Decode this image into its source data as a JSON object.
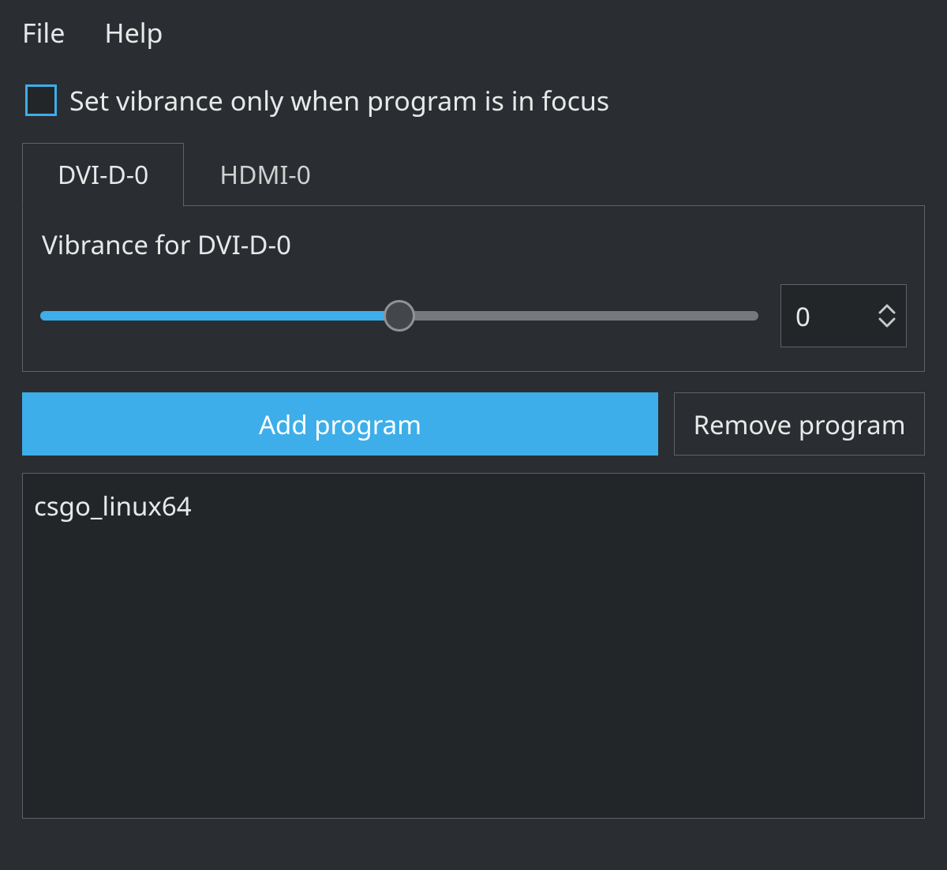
{
  "menu": {
    "file": "File",
    "help": "Help"
  },
  "focus_checkbox": {
    "checked": false,
    "label": "Set vibrance only when program is in focus"
  },
  "tabs": [
    {
      "id": "dvi-d-0",
      "label": "DVI-D-0",
      "active": true
    },
    {
      "id": "hdmi-0",
      "label": "HDMI-0",
      "active": false
    }
  ],
  "active_tab": {
    "vibrance_label": "Vibrance for DVI-D-0",
    "slider_value": 0,
    "slider_min": -100,
    "slider_max": 100,
    "spinbox_value": "0"
  },
  "buttons": {
    "add_program": "Add program",
    "remove_program": "Remove program"
  },
  "programs": [
    "csgo_linux64"
  ],
  "colors": {
    "accent": "#3daee9",
    "bg": "#2a2e32",
    "panel": "#232629",
    "border": "#5f6368",
    "text": "#e8e8e8"
  }
}
